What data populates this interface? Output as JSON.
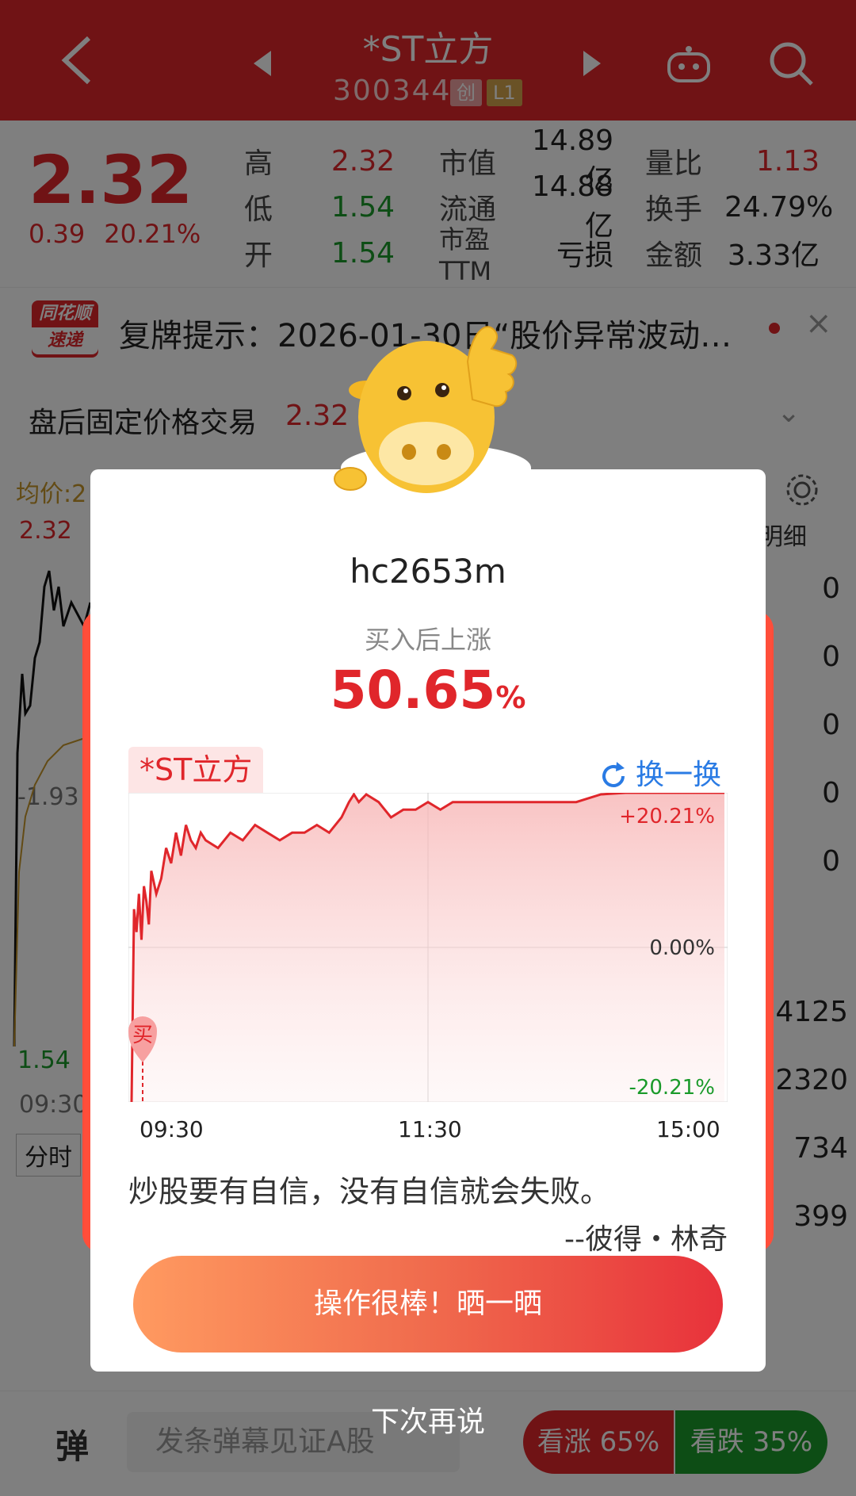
{
  "header": {
    "title": "*ST立方",
    "code": "300344",
    "tag_board": "创",
    "tag_level": "L1"
  },
  "quote": {
    "price": "2.32",
    "change": "0.39",
    "change_pct": "20.21%",
    "rows": [
      {
        "l1": "高",
        "v1": "2.32",
        "c1": "red",
        "l2": "市值",
        "v2": "14.89亿",
        "l3": "量比",
        "v3": "1.13",
        "c3": "red"
      },
      {
        "l1": "低",
        "v1": "1.54",
        "c1": "green",
        "l2": "流通",
        "v2": "14.88亿",
        "l3": "换手",
        "v3": "24.79%",
        "c3": "black"
      },
      {
        "l1": "开",
        "v1": "1.54",
        "c1": "green",
        "l2": "市盈TTM",
        "v2": "亏损",
        "l3": "金额",
        "v3": "3.33亿",
        "c3": "black"
      }
    ]
  },
  "notice": {
    "logo_top": "同花顺",
    "logo_bottom": "速递",
    "text": "复牌提示：2026-01-30日“股价异常波动…"
  },
  "after_hours": {
    "label": "盘后固定价格交易",
    "value": "2.32"
  },
  "bg_chart": {
    "avg_label": "均价:2",
    "high": "2.32",
    "mid": "-1.93",
    "low": "1.54",
    "time_start": "09:30",
    "tab_fenshi": "分时",
    "detail_label": "明细",
    "side_values": [
      "0",
      "0",
      "0",
      "0",
      "0"
    ],
    "side_values2": [
      "4125",
      "2320",
      "734",
      "399"
    ]
  },
  "bottom_bar": {
    "dan_label": "弹",
    "input_placeholder": "发条弹幕见证A股",
    "bull_label": "看涨 65%",
    "bear_label": "看跌 35%"
  },
  "popup": {
    "username": "hc2653m",
    "subtitle": "买入后上涨",
    "gain_value": "50.65",
    "gain_unit": "%",
    "stock_tag": "*ST立方",
    "refresh_label": "换一换",
    "quote": "炒股要有自信，没有自信就会失败。",
    "author": "--彼得・林奇",
    "share_button": "操作很棒！晒一晒",
    "dismiss": "下次再说",
    "buy_marker": "买",
    "colors": {
      "up": "#e0262b",
      "down": "#1a9a2a",
      "link": "#2a7be4"
    }
  },
  "chart_data": {
    "type": "line",
    "x_ticks": [
      "09:30",
      "11:30",
      "15:00"
    ],
    "y_ticks": [
      "+20.21%",
      "0.00%",
      "-20.21%"
    ],
    "ylim": [
      -20.21,
      20.21
    ],
    "series": [
      {
        "x": [
          0,
          1,
          2,
          3,
          4,
          5,
          6,
          7,
          8,
          10,
          12,
          14,
          16,
          18,
          20,
          22,
          24,
          26,
          28,
          30,
          35,
          40,
          45,
          50,
          55,
          60,
          65,
          70,
          75,
          80,
          85,
          88,
          90,
          92,
          95,
          100,
          105,
          110,
          115,
          120,
          125,
          130,
          135,
          140,
          150,
          160,
          170,
          180,
          190,
          200,
          210,
          220,
          230,
          240
        ],
        "values": [
          -20.21,
          5,
          2,
          7,
          1,
          8,
          6,
          3,
          10,
          7,
          9,
          13,
          11,
          15,
          12,
          16,
          14,
          13,
          15,
          14,
          13,
          15,
          14,
          16,
          15,
          14,
          15,
          15,
          16,
          15,
          17,
          19,
          20,
          19,
          20,
          19,
          17,
          18,
          18,
          19,
          18,
          19,
          19,
          19,
          19,
          19,
          19,
          19,
          20,
          20.21,
          20.21,
          20.21,
          20.21,
          20.21
        ]
      }
    ]
  }
}
